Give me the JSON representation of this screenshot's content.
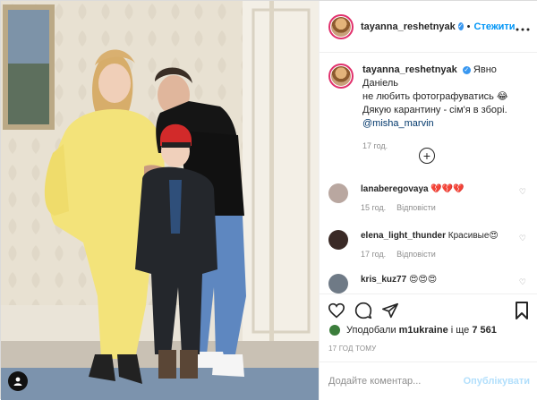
{
  "post": {
    "username": "tayanna_reshetnyak",
    "verified_icon": "verified-badge-icon",
    "follow_label": "Стежити",
    "dot": "•",
    "more_icon": "more-options-icon",
    "caption_lines": [
      "Явно Даніель",
      "не любить фотографуватись 😂",
      "Дякую карантину - сім'я в зборі."
    ],
    "caption_mention": "@misha_marvin",
    "caption_time": "17 год."
  },
  "comments": [
    {
      "user": "lanaberegovaya",
      "text": "💔💔💔",
      "time": "15 год.",
      "reply": "Відповісти",
      "avatar_color": "#b9a7a0"
    },
    {
      "user": "elena_light_thunder",
      "text": "Красивые😍",
      "time": "17 год.",
      "reply": "Відповісти",
      "avatar_color": "#3a2a26"
    },
    {
      "user": "kris_kuz77",
      "text": "😍😍😍",
      "time": "",
      "reply": "",
      "avatar_color": "#6f7a86"
    }
  ],
  "actions": {
    "like_icon": "heart-icon",
    "comment_icon": "comment-icon",
    "share_icon": "share-icon",
    "save_icon": "bookmark-icon",
    "load_more_icon": "plus-circle-icon"
  },
  "likes": {
    "prefix": "Уподобали",
    "user": "m1ukraine",
    "suffix": "і ще",
    "count": "7 561"
  },
  "post_time": "17 ГОД ТОМУ",
  "add_comment": {
    "placeholder": "Додайте коментар...",
    "publish_label": "Опублікувати"
  },
  "colors": {
    "accent": "#0095f6",
    "publish_disabled": "#b2dffc",
    "meta": "#8e8e8e"
  }
}
